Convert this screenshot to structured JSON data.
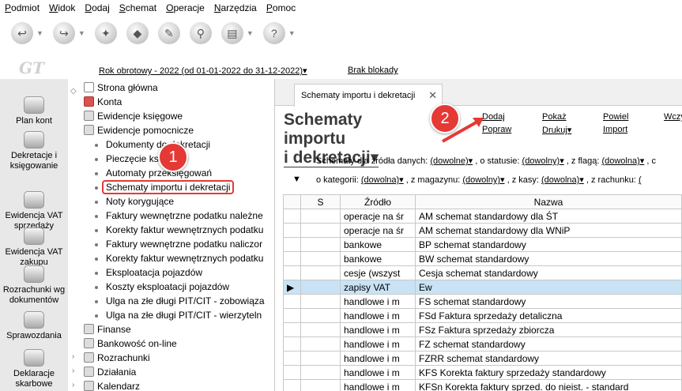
{
  "menu": [
    "Podmiot",
    "Widok",
    "Dodaj",
    "Schemat",
    "Operacje",
    "Narzędzia",
    "Pomoc"
  ],
  "toolbar_icons": [
    "back-icon",
    "forward-icon",
    "stamp-icon",
    "eraser-icon",
    "broom-icon",
    "binoculars-icon",
    "printer-icon",
    "help-icon"
  ],
  "header": {
    "logo": "GT",
    "year": "Rok obrotowy - 2022  (od 01-01-2022 do 31-12-2022)▾",
    "lock": "Brak blokady"
  },
  "iconbar": [
    {
      "label": "Plan kont",
      "icon": "coins-icon"
    },
    {
      "label": "Dekretacje i księgowanie",
      "icon": "paperclip-icon"
    },
    {
      "label": "Ewidencja VAT sprzedaży",
      "icon": "coins-icon"
    },
    {
      "label": "Ewidencja VAT zakupu",
      "icon": "coins-icon"
    },
    {
      "label": "Rozrachunki wg dokumentów",
      "icon": "check-icon"
    },
    {
      "label": "Sprawozdania",
      "icon": "chart-icon"
    },
    {
      "label": "Deklaracje skarbowe",
      "icon": "form-icon"
    }
  ],
  "tree": [
    {
      "label": "Strona główna",
      "lvl": 0,
      "icon": "doc"
    },
    {
      "label": "Konta",
      "lvl": 0,
      "icon": "red"
    },
    {
      "label": "Ewidencje księgowe",
      "lvl": 0,
      "icon": "gray"
    },
    {
      "label": "Ewidencje pomocnicze",
      "lvl": 0,
      "icon": "gray"
    },
    {
      "label": "Dokumenty do dekretacji",
      "lvl": 1
    },
    {
      "label": "Pieczęcie księgowe",
      "lvl": 1
    },
    {
      "label": "Automaty przeksięgowań",
      "lvl": 1
    },
    {
      "label": "Schematy importu i dekretacji",
      "lvl": 1,
      "selected": true
    },
    {
      "label": "Noty korygujące",
      "lvl": 1
    },
    {
      "label": "Faktury wewnętrzne podatku należne",
      "lvl": 1
    },
    {
      "label": "Korekty faktur wewnętrznych podatku",
      "lvl": 1
    },
    {
      "label": "Faktury wewnętrzne podatku naliczor",
      "lvl": 1
    },
    {
      "label": "Korekty faktur wewnętrznych podatku",
      "lvl": 1
    },
    {
      "label": "Eksploatacja pojazdów",
      "lvl": 1
    },
    {
      "label": "Koszty eksploatacji pojazdów",
      "lvl": 1
    },
    {
      "label": "Ulga na złe długi PIT/CIT - zobowiąza",
      "lvl": 1
    },
    {
      "label": "Ulga na złe długi PIT/CIT - wierzyteln",
      "lvl": 1
    },
    {
      "label": "Finanse",
      "lvl": 0,
      "icon": "gray"
    },
    {
      "label": "Bankowość on-line",
      "lvl": 0,
      "icon": "gray"
    },
    {
      "label": "Rozrachunki",
      "lvl": 0,
      "icon": "gray"
    },
    {
      "label": "Działania",
      "lvl": 0,
      "icon": "gray"
    },
    {
      "label": "Kalendarz",
      "lvl": 0,
      "icon": "gray"
    }
  ],
  "tab": {
    "label": "Schematy importu i dekretacji",
    "close": "✕"
  },
  "title": {
    "line1": "Schematy importu",
    "line2": "i dekretacji▾"
  },
  "actions": {
    "dodaj": "Dodaj",
    "popraw": "Popraw",
    "pokaz": "Pokaż",
    "drukuj": "Drukuj▾",
    "powiel": "Powiel",
    "import": "Import",
    "wczytaj": "Wczy"
  },
  "filters": {
    "row1": [
      "Schematy dla źródła danych:",
      "(dowolne)▾",
      ", o statusie:",
      "(dowolny)▾",
      ", z flagą:",
      "(dowolna)▾",
      ", c"
    ],
    "row2": [
      "o kategorii:",
      "(dowolna)▾",
      ", z magazynu:",
      "(dowolny)▾",
      ", z kasy:",
      "(dowolna)▾",
      ", z rachunku:",
      "("
    ]
  },
  "table": {
    "headers": [
      "",
      "S",
      "Źródło",
      "Nazwa"
    ],
    "rows": [
      {
        "src": "operacje na śr",
        "name": "AM schemat standardowy dla ŚT"
      },
      {
        "src": "operacje na śr",
        "name": "AM schemat standardowy dla WNiP"
      },
      {
        "src": "bankowe",
        "name": "BP schemat standardowy"
      },
      {
        "src": "bankowe",
        "name": "BW schemat standardowy"
      },
      {
        "src": "cesje (wszyst",
        "name": "Cesja schemat standardowy"
      },
      {
        "src": "zapisy VAT",
        "name": "Ew",
        "current": true
      },
      {
        "src": "handlowe i m",
        "name": "FS schemat standardowy"
      },
      {
        "src": "handlowe i m",
        "name": "FSd Faktura sprzedaży detaliczna"
      },
      {
        "src": "handlowe i m",
        "name": "FSz Faktura sprzedaży zbiorcza"
      },
      {
        "src": "handlowe i m",
        "name": "FZ schemat standardowy"
      },
      {
        "src": "handlowe i m",
        "name": "FZRR schemat standardowy"
      },
      {
        "src": "handlowe i m",
        "name": "KFS Korekta faktury sprzedaży standardowy"
      },
      {
        "src": "handlowe i m",
        "name": "KFSn Korekta faktury sprzed. do nieist. - standard"
      }
    ]
  },
  "badges": [
    "1",
    "2"
  ],
  "colors": {
    "badge": "#e53935",
    "selection": "#c9e3f5"
  }
}
